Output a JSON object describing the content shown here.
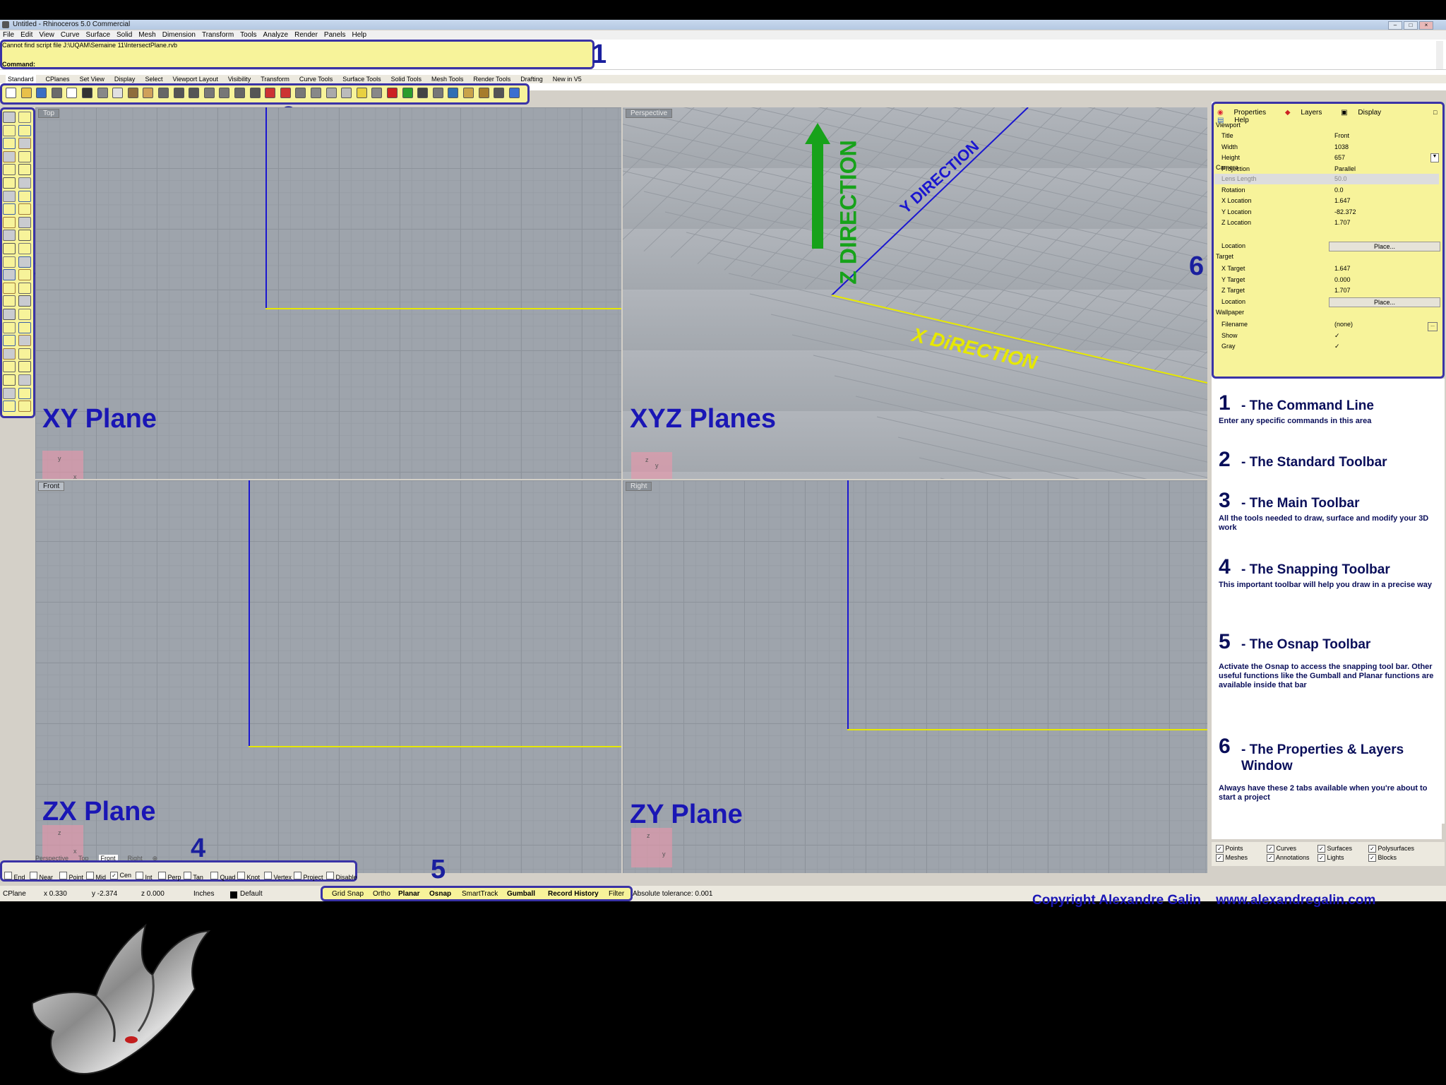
{
  "window": {
    "title": "Untitled - Rhinoceros 5.0 Commercial"
  },
  "menubar": [
    "File",
    "Edit",
    "View",
    "Curve",
    "Surface",
    "Solid",
    "Mesh",
    "Dimension",
    "Transform",
    "Tools",
    "Analyze",
    "Render",
    "Panels",
    "Help"
  ],
  "command": {
    "history": "Cannot find script file J:\\UQAM\\Semaine 11\\IntersectPlane.rvb",
    "prompt": "Command:"
  },
  "toolbar_tabs": [
    "Standard",
    "CPlanes",
    "Set View",
    "Display",
    "Select",
    "Viewport Layout",
    "Visibility",
    "Transform",
    "Curve Tools",
    "Surface Tools",
    "Solid Tools",
    "Mesh Tools",
    "Render Tools",
    "Drafting",
    "New in V5"
  ],
  "callouts": [
    "1",
    "2",
    "3",
    "4",
    "5",
    "6"
  ],
  "viewports": {
    "top": {
      "label": "Top",
      "plane": "XY Plane",
      "ax1": "y",
      "ax2": "x"
    },
    "perspective": {
      "label": "Perspective",
      "plane": "XYZ Planes",
      "ax1": "z",
      "ax2": "y",
      "ax3": "x",
      "z_dir": "Z DIRECTION",
      "y_dir": "Y DIRECTION",
      "x_dir": "X DiRECTION"
    },
    "front": {
      "label": "Front",
      "plane": "ZX Plane",
      "ax1": "z",
      "ax2": "x"
    },
    "right": {
      "label": "Right",
      "plane": "ZY Plane",
      "ax1": "z",
      "ax2": "y"
    }
  },
  "viewport_tabs": [
    "Perspective",
    "Top",
    "Front",
    "Right"
  ],
  "properties": {
    "tabs": [
      "Properties",
      "Layers",
      "Display",
      "Help"
    ],
    "sections": {
      "viewport": "Viewport",
      "camera": "Camera",
      "target": "Target",
      "wallpaper": "Wallpaper"
    },
    "viewport_rows": [
      {
        "k": "Title",
        "v": "Front"
      },
      {
        "k": "Width",
        "v": "1038"
      },
      {
        "k": "Height",
        "v": "657"
      },
      {
        "k": "Projection",
        "v": "Parallel"
      }
    ],
    "camera_rows": [
      {
        "k": "Lens Length",
        "v": "50.0"
      },
      {
        "k": "Rotation",
        "v": "0.0"
      },
      {
        "k": "X Location",
        "v": "1.647"
      },
      {
        "k": "Y Location",
        "v": "-82.372"
      },
      {
        "k": "Z Location",
        "v": "1.707"
      }
    ],
    "camera_location": {
      "k": "Location",
      "btn": "Place..."
    },
    "target_rows": [
      {
        "k": "X Target",
        "v": "1.647"
      },
      {
        "k": "Y Target",
        "v": "0.000"
      },
      {
        "k": "Z Target",
        "v": "1.707"
      }
    ],
    "target_location": {
      "k": "Location",
      "btn": "Place..."
    },
    "wallpaper_rows": [
      {
        "k": "Filename",
        "v": "(none)"
      },
      {
        "k": "Show",
        "v": "✓"
      },
      {
        "k": "Gray",
        "v": "✓"
      }
    ]
  },
  "notes": [
    {
      "num": "1",
      "title": "- The Command Line",
      "body": "Enter any specific commands in this area"
    },
    {
      "num": "2",
      "title": "- The Standard Toolbar",
      "body": ""
    },
    {
      "num": "3",
      "title": "- The Main Toolbar",
      "body": "All the tools needed to draw, surface and modify your 3D work"
    },
    {
      "num": "4",
      "title": "- The Snapping Toolbar",
      "body": "This important toolbar will help you draw in a precise way"
    },
    {
      "num": "5",
      "title": "- The Osnap Toolbar",
      "body": "Activate the Osnap to access the snapping tool bar. Other useful functions like the Gumball and Planar functions are available inside that bar"
    },
    {
      "num": "6",
      "title": "- The Properties & Layers Window",
      "body": "Always have these 2 tabs available when you're about to start a project"
    }
  ],
  "filters": [
    "Points",
    "Curves",
    "Surfaces",
    "Polysurfaces",
    "Meshes",
    "Annotations",
    "Lights",
    "Blocks"
  ],
  "osnap_items": [
    "End",
    "Near",
    "Point",
    "Mid",
    "Cen",
    "Int",
    "Perp",
    "Tan",
    "Quad",
    "Knot",
    "Vertex",
    "Project",
    "Disable"
  ],
  "status": {
    "cplane": "CPlane",
    "x": "x 0.330",
    "y": "y -2.374",
    "z": "z 0.000",
    "units": "Inches",
    "layer": "Default",
    "toggles": [
      "Grid Snap",
      "Ortho",
      "Planar",
      "Osnap",
      "SmartTrack",
      "Gumball",
      "Record History",
      "Filter"
    ],
    "tolerance": "Absolute tolerance: 0.001"
  },
  "copyright": "Copyright Alexandre Galin    www.alexandregalin.com",
  "colors": {
    "callout": "#1a1f9e",
    "highlight": "#f7f39a",
    "x_axis": "#e6e800",
    "y_axis": "#1a16d0",
    "z_arrow": "#17a21a"
  }
}
